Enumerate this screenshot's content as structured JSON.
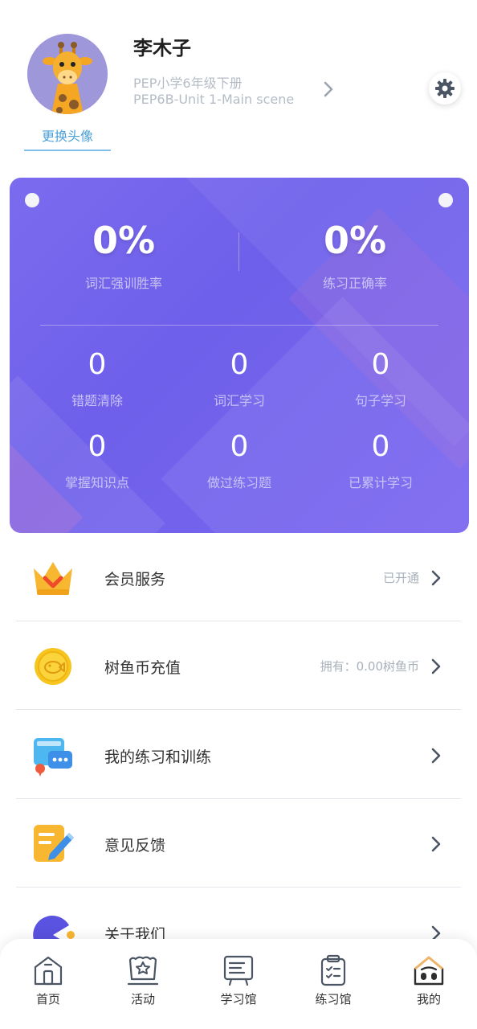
{
  "profile": {
    "username": "李木子",
    "change_avatar_label": "更换头像",
    "book_name": "PEP小学6年级下册",
    "unit_name": "PEP6B-Unit 1-Main scene"
  },
  "stats": {
    "vocab_win_rate": {
      "value": "0%",
      "label": "词汇强训胜率"
    },
    "practice_accuracy": {
      "value": "0%",
      "label": "练习正确率"
    },
    "items": [
      {
        "value": "0",
        "label": "错题清除"
      },
      {
        "value": "0",
        "label": "词汇学习"
      },
      {
        "value": "0",
        "label": "句子学习"
      },
      {
        "value": "0",
        "label": "掌握知识点"
      },
      {
        "value": "0",
        "label": "做过练习题"
      },
      {
        "value": "0",
        "label": "已累计学习"
      }
    ]
  },
  "menu": [
    {
      "label": "会员服务",
      "status": "已开通",
      "icon": "crown-icon"
    },
    {
      "label": "树鱼币充值",
      "status": "拥有：0.00树鱼币",
      "icon": "coin-icon"
    },
    {
      "label": "我的练习和训练",
      "status": "",
      "icon": "chat-bubbles-icon"
    },
    {
      "label": "意见反馈",
      "status": "",
      "icon": "notepad-pencil-icon"
    },
    {
      "label": "关于我们",
      "status": "",
      "icon": "pacman-icon"
    }
  ],
  "bottom_nav": [
    {
      "label": "首页",
      "icon": "home-icon",
      "active": false
    },
    {
      "label": "活动",
      "icon": "activity-icon",
      "active": false
    },
    {
      "label": "学习馆",
      "icon": "study-board-icon",
      "active": false
    },
    {
      "label": "练习馆",
      "icon": "practice-clipboard-icon",
      "active": false
    },
    {
      "label": "我的",
      "icon": "profile-house-icon",
      "active": true
    }
  ],
  "colors": {
    "card_gradient_start": "#7b6bef",
    "card_gradient_end": "#7a66f0",
    "accent_blue": "#4a9fd8",
    "muted_text": "#a8b0ba"
  }
}
